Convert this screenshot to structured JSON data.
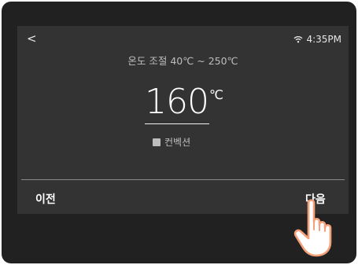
{
  "nav": {
    "back_icon": "chevron-left-icon",
    "back_glyph": "<"
  },
  "status_bar": {
    "wifi_icon": "wifi-icon",
    "time": "4:35PM"
  },
  "header": {
    "range_label": "온도 조절 40℃ ~ 250℃"
  },
  "temperature": {
    "value": "160",
    "unit": "℃"
  },
  "mode": {
    "icon": "convection-icon",
    "label": "컨벡션"
  },
  "footer": {
    "prev_label": "이전",
    "next_label": "다음"
  },
  "colors": {
    "device": "#212121",
    "screen": "#333333",
    "accent": "#f4a07a"
  }
}
